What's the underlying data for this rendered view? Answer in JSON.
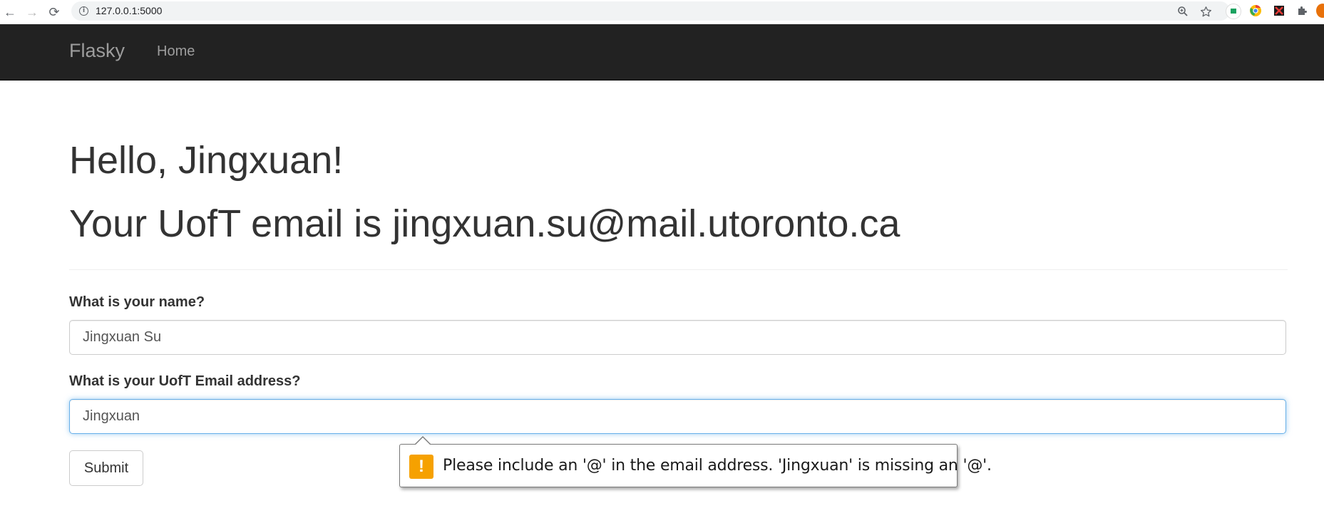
{
  "browser": {
    "url": "127.0.0.1:5000",
    "back_icon": "←",
    "forward_icon": "→",
    "reload_icon": "⟳"
  },
  "navbar": {
    "brand": "Flasky",
    "home_label": "Home",
    "background": "#222222"
  },
  "main": {
    "greeting": "Hello, Jingxuan!",
    "email_line": "Your UofT email is jingxuan.su@mail.utoronto.ca"
  },
  "form": {
    "name_label": "What is your name?",
    "name_value": "Jingxuan Su",
    "email_label": "What is your UofT Email address?",
    "email_value": "Jingxuan",
    "submit_label": "Submit"
  },
  "validation": {
    "message": "Please include an '@' in the email address. 'Jingxuan' is missing an '@'.",
    "icon": "!",
    "icon_color": "#f6a100"
  }
}
